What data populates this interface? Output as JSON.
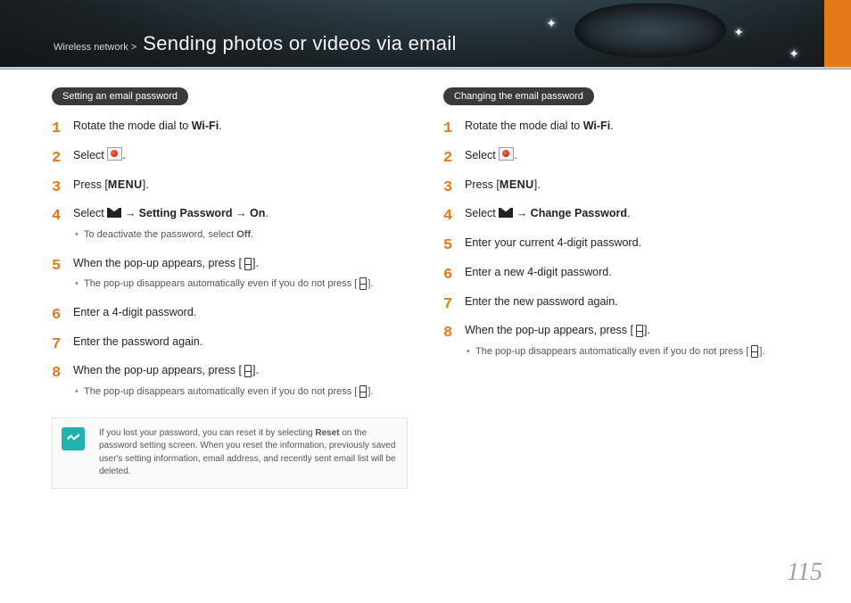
{
  "header": {
    "breadcrumb": "Wireless network >",
    "title": "Sending photos or videos via email"
  },
  "page_number": "115",
  "left": {
    "heading": "Setting an email password",
    "note": {
      "prefix": "If you lost your password, you can reset it by selecting ",
      "bold": "Reset",
      "suffix": " on the password setting screen. When you reset the information, previously saved user's setting information, email address, and recently sent email list will be deleted."
    },
    "steps": [
      {
        "t1": "Rotate the mode dial to ",
        "icon": "wifi",
        "t2": "."
      },
      {
        "t1": "Select ",
        "icon": "redbox",
        "t2": "."
      },
      {
        "t1": "Press [",
        "icon": "menu",
        "t2": "]."
      },
      {
        "t1": "Select ",
        "icon": "env",
        "t2": " → ",
        "b1": "Setting Password",
        "t3": " → ",
        "b2": "On",
        "t4": ".",
        "sub": {
          "pre": "To deactivate the password, select ",
          "bold": "Off",
          "post": "."
        }
      },
      {
        "t1": "When the pop-up appears, press [",
        "icon": "glyph",
        "t2": "].",
        "sub": {
          "pre": "The pop-up disappears automatically even if you do not press [",
          "glyph": true,
          "post": "]."
        }
      },
      {
        "t1": "Enter a 4-digit password."
      },
      {
        "t1": "Enter the password again."
      },
      {
        "t1": "When the pop-up appears, press [",
        "icon": "glyph",
        "t2": "].",
        "sub": {
          "pre": "The pop-up disappears automatically even if you do not press [",
          "glyph": true,
          "post": "]."
        }
      }
    ]
  },
  "right": {
    "heading": "Changing the email password",
    "steps": [
      {
        "t1": "Rotate the mode dial to ",
        "icon": "wifi",
        "t2": "."
      },
      {
        "t1": "Select ",
        "icon": "redbox",
        "t2": "."
      },
      {
        "t1": "Press [",
        "icon": "menu",
        "t2": "]."
      },
      {
        "t1": "Select ",
        "icon": "env",
        "t2": " → ",
        "b1": "Change Password",
        "t3": "."
      },
      {
        "t1": "Enter your current 4-digit password."
      },
      {
        "t1": "Enter a new 4-digit password."
      },
      {
        "t1": "Enter the new password again."
      },
      {
        "t1": "When the pop-up appears, press [",
        "icon": "glyph",
        "t2": "].",
        "sub": {
          "pre": "The pop-up disappears automatically even if you do not press [",
          "glyph": true,
          "post": "]."
        }
      }
    ]
  },
  "icon_labels": {
    "wifi": "Wi-Fi",
    "menu": "MENU"
  }
}
